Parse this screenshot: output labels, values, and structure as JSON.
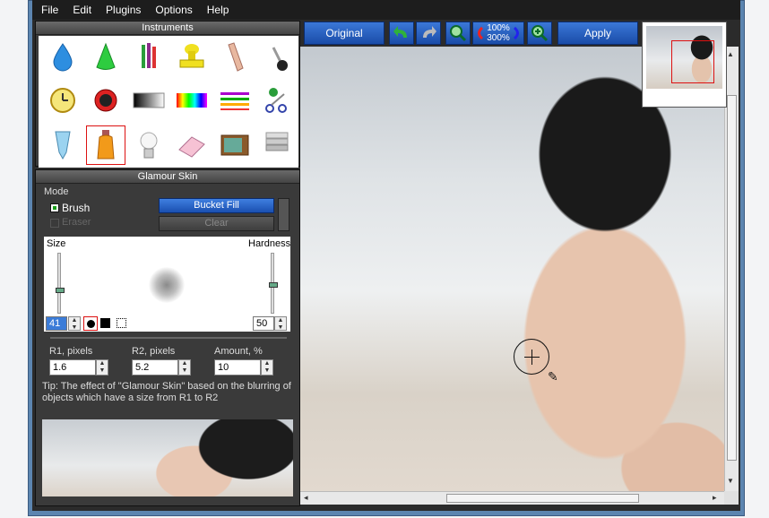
{
  "menu": [
    "File",
    "Edit",
    "Plugins",
    "Options",
    "Help"
  ],
  "instruments": {
    "title": "Instruments",
    "tools": [
      "drop-icon",
      "cone-icon",
      "pencils-icon",
      "stamp-icon",
      "finger-icon",
      "pin-icon",
      "clock-icon",
      "eye-icon",
      "gradient-icon",
      "rainbow-icon",
      "lines-icon",
      "scissors-icon",
      "tube-icon",
      "bottle-icon",
      "bulb-icon",
      "eraser-icon",
      "tv-icon",
      "text-stack-icon"
    ],
    "selected_index": 13
  },
  "glamour": {
    "title": "Glamour Skin",
    "mode_label": "Mode",
    "brush_label": "Brush",
    "eraser_label": "Eraser",
    "bucket_fill_label": "Bucket Fill",
    "clear_label": "Clear",
    "size_label": "Size",
    "hardness_label": "Hardness",
    "size_value": "41",
    "hardness_value": "50",
    "r1_label": "R1, pixels",
    "r2_label": "R2, pixels",
    "amount_label": "Amount, %",
    "r1_value": "1.6",
    "r2_value": "5.2",
    "amount_value": "10",
    "tip": "Tip: The effect of \"Glamour Skin\" based on the blurring of objects which have a size from R1 to R2"
  },
  "toolbar": {
    "original_label": "Original",
    "zoom_top": "100%",
    "zoom_bottom": "300%",
    "apply_label": "Apply"
  },
  "colors": {
    "accent": "#1a4ca8",
    "panel": "#3a3a3a",
    "selection": "#dd1111"
  }
}
